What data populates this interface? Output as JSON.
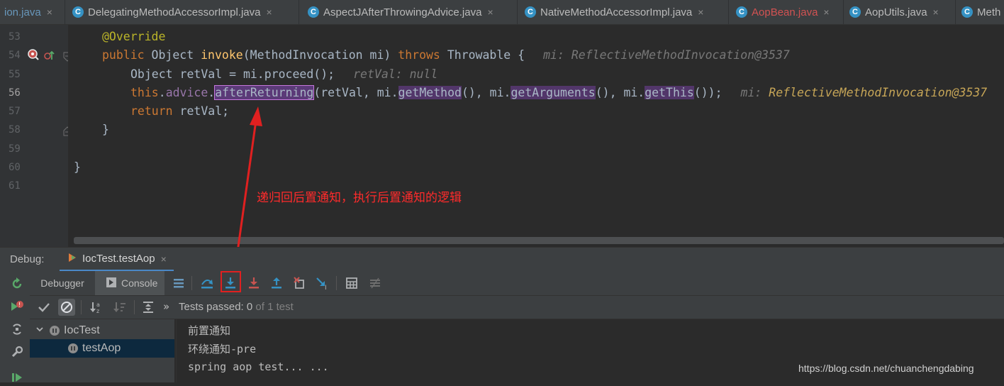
{
  "tabs": [
    {
      "label": "ion.java",
      "close": "×",
      "icon": "none",
      "color": "blue"
    },
    {
      "label": "DelegatingMethodAccessorImpl.java",
      "close": "×",
      "icon": "class-icon"
    },
    {
      "label": "AspectJAfterThrowingAdvice.java",
      "close": "×",
      "icon": "class-icon"
    },
    {
      "label": "NativeMethodAccessorImpl.java",
      "close": "×",
      "icon": "class-icon"
    },
    {
      "label": "AopBean.java",
      "close": "×",
      "icon": "class-icon",
      "color": "red"
    },
    {
      "label": "AopUtils.java",
      "close": "×",
      "icon": "class-icon"
    },
    {
      "label": "Meth",
      "close": "",
      "icon": "class-icon"
    }
  ],
  "editor": {
    "line_numbers": [
      "53",
      "54",
      "55",
      "56",
      "57",
      "58",
      "59",
      "60",
      "61"
    ],
    "current_line": "56",
    "line53": {
      "annotation": "@Override"
    },
    "line54": {
      "kw1": "public",
      "type": "Object",
      "method": "invoke",
      "params": "(MethodInvocation mi)",
      "kw2": "throws",
      "ex": "Throwable {",
      "hint": "mi: ReflectiveMethodInvocation@3537"
    },
    "line55": {
      "code": "Object retVal = mi.proceed();",
      "hint": "retVal: null"
    },
    "line56": {
      "this": "this",
      "dot1": ".",
      "field": "advice",
      "dot2": ".",
      "call": "afterReturning",
      "arg1": "(retVal, mi.",
      "m1": "getMethod",
      "arg2": "(), mi.",
      "m2": "getArguments",
      "arg3": "(), mi.",
      "m3": "getThis",
      "arg4": "());",
      "hint_key": "mi:",
      "hint_val": "ReflectiveMethodInvocation@3537"
    },
    "line57": {
      "kw": "return",
      "code": " retVal;"
    },
    "line58": {
      "code": "}"
    },
    "line60": {
      "code": "}"
    }
  },
  "annotation": {
    "text": "递归回后置通知，执行后置通知的逻辑",
    "color": "#ff2b2b"
  },
  "debug": {
    "label": "Debug:",
    "session_tab": "IocTest.testAop",
    "session_close": "×",
    "subtabs": {
      "debugger": "Debugger",
      "console": "Console"
    },
    "toolbar_icons": [
      "show-execution-point-icon",
      "step-over-icon",
      "step-into-icon",
      "force-step-into-icon",
      "step-out-icon",
      "drop-frame-icon",
      "run-to-cursor-icon",
      "evaluate-expression-icon",
      "trace-icon"
    ],
    "tests_chevron": "»",
    "tests_passed_label": "Tests passed:",
    "tests_passed_count": "0",
    "tests_total": "of 1 test",
    "tree": [
      {
        "label": "IocTest",
        "expanded": true
      },
      {
        "label": "testAop",
        "selected": true
      }
    ],
    "console_lines": [
      "前置通知",
      "环绕通知-pre",
      "spring aop test... ..."
    ]
  },
  "watermark": "https://blog.csdn.net/chuanchengdabing"
}
